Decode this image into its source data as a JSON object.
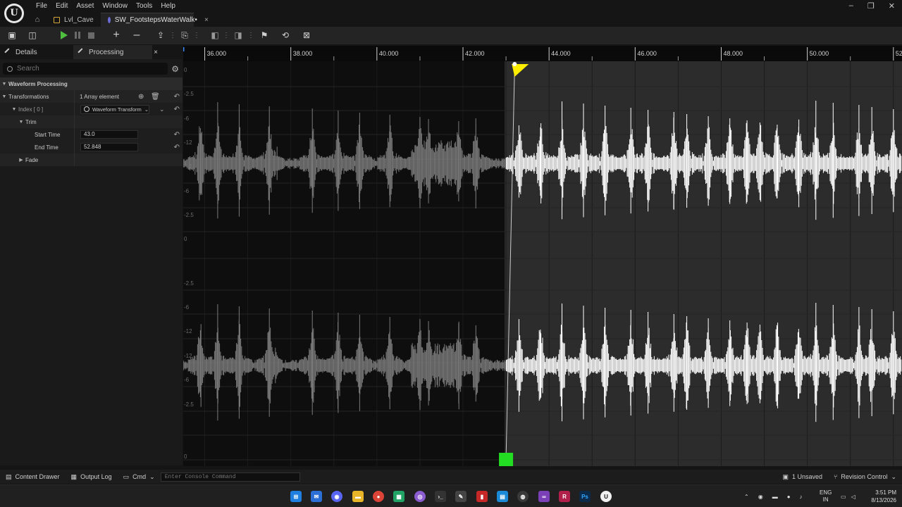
{
  "menu": [
    "File",
    "Edit",
    "Asset",
    "Window",
    "Tools",
    "Help"
  ],
  "window_controls": [
    "–",
    "❐",
    "✕"
  ],
  "tabs": {
    "level": "Lvl_Cave",
    "asset": "SW_FootstepsWaterWalk•",
    "close": "×"
  },
  "panel": {
    "details_tab": "Details",
    "processing_tab": "Processing",
    "close": "×",
    "search_placeholder": "Search",
    "section": "Waveform Processing",
    "transformations_label": "Transformations",
    "array_count": "1 Array element",
    "index_label": "Index [ 0 ]",
    "transform_value": "Waveform Transform",
    "trim_label": "Trim",
    "start_time_label": "Start Time",
    "start_time_value": "43.0",
    "end_time_label": "End Time",
    "end_time_value": "52.848",
    "fade_label": "Fade"
  },
  "waveform": {
    "ruler_ticks": [
      "36.000",
      "38.000",
      "40.000",
      "42.000",
      "44.000",
      "46.000",
      "48.000",
      "50.000",
      "52.0"
    ],
    "db_labels": [
      "0",
      "-2.5",
      "-6",
      "-12",
      "-12",
      "-6",
      "-2.5",
      "0",
      "-2.5",
      "-6",
      "-12",
      "-12",
      "-6",
      "-2.5",
      "0"
    ],
    "trim_start": 43.0,
    "trim_end": 52.848,
    "playhead_time": 43.2,
    "visible_start": 35.5,
    "visible_end": 52.2,
    "colors": {
      "background": "#2c2c2c",
      "trimmed_region": "#0e0e0e",
      "waveform_active": "#ffffff",
      "waveform_trimmed": "#7a7a7a",
      "start_marker": "#ffee00",
      "end_marker": "#c0304a",
      "trim_handle": "#22dd22"
    }
  },
  "statusbar": {
    "content_drawer": "Content Drawer",
    "output_log": "Output Log",
    "cmd": "Cmd",
    "console_placeholder": "Enter Console Command",
    "unsaved": "1 Unsaved",
    "revision_control": "Revision Control"
  },
  "taskbar": {
    "lang_top": "ENG",
    "lang_bottom": "IN",
    "time": "3:51 PM",
    "date": "8/13/2026"
  }
}
